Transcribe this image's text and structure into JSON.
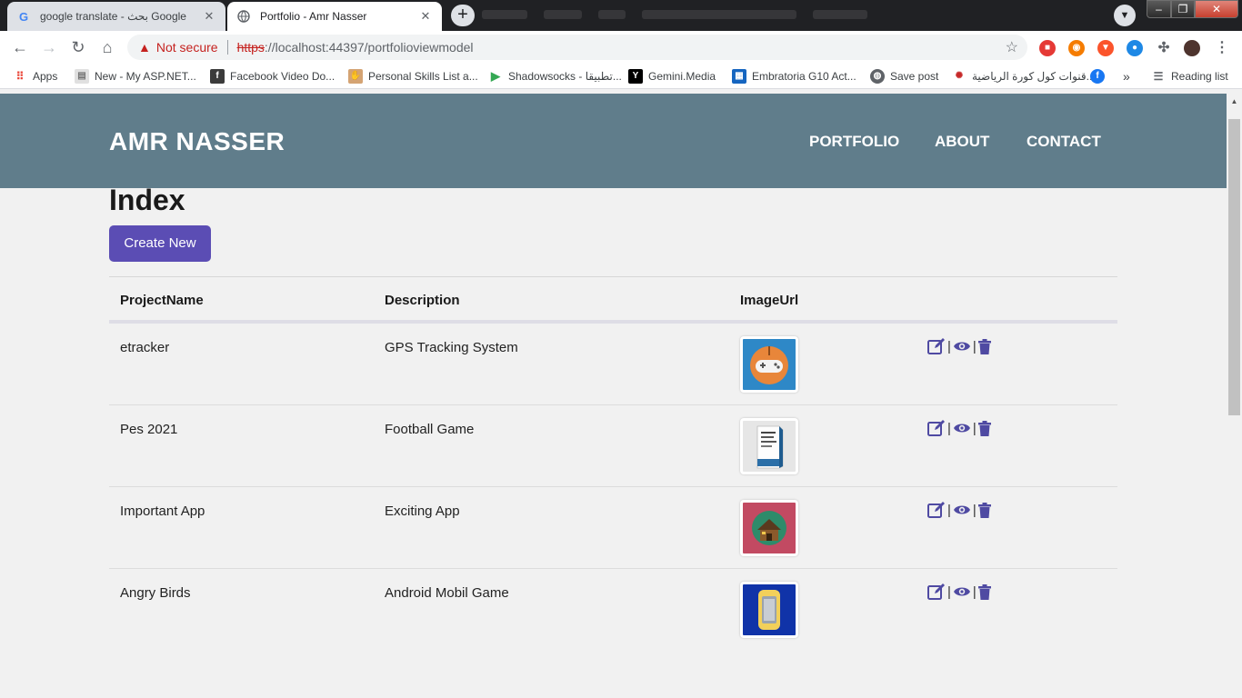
{
  "browser": {
    "tabs": [
      {
        "title": "google translate - بحث Google",
        "favicon": "google-icon",
        "active": false
      },
      {
        "title": "Portfolio - Amr Nasser",
        "favicon": "globe-icon",
        "active": true
      }
    ],
    "close_glyph": "✕",
    "new_tab_glyph": "+",
    "address": {
      "warning_label": "Not secure",
      "scheme": "https",
      "rest": "://localhost:44397/portfolioviewmodel"
    },
    "bookmarks": [
      {
        "label": "Apps",
        "icon": "apps-grid-icon",
        "color": "#4285f4"
      },
      {
        "label": "New - My ASP.NET...",
        "icon": "page-icon",
        "color": "#9e9e9e"
      },
      {
        "label": "Facebook Video Do...",
        "icon": "facebook-f-icon",
        "color": "#3b3b3b"
      },
      {
        "label": "Personal Skills List a...",
        "icon": "hand-icon",
        "color": "#d4a373"
      },
      {
        "label": "Shadowsocks - تطبيقا...",
        "icon": "play-store-icon",
        "color": "#34a853"
      },
      {
        "label": "Gemini.Media",
        "icon": "y-logo-icon",
        "color": "#000000"
      },
      {
        "label": "Embratoria G10 Act...",
        "icon": "site-icon",
        "color": "#1565c0"
      },
      {
        "label": "Save post",
        "icon": "globe-icon",
        "color": "#5f6368"
      },
      {
        "label": "قنوات كول كورة الرياضية...",
        "icon": "club-icon",
        "color": "#c62828"
      },
      {
        "label": "",
        "icon": "facebook-icon",
        "color": "#1877f2"
      }
    ],
    "bookmarks_more": "»",
    "reading_list": "Reading list"
  },
  "site": {
    "brand": "AMR NASSER",
    "nav": [
      "PORTFOLIO",
      "ABOUT",
      "CONTACT"
    ],
    "header_color": "#607d8b",
    "accent_color": "#5b4db4"
  },
  "page": {
    "title": "Index",
    "create_label": "Create New",
    "columns": [
      "ProjectName",
      "Description",
      "ImageUrl"
    ],
    "rows": [
      {
        "name": "etracker",
        "description": "GPS Tracking System",
        "image": "gamepad-thumbnail"
      },
      {
        "name": "Pes 2021",
        "description": "Football Game",
        "image": "book-cover-thumbnail"
      },
      {
        "name": "Important App",
        "description": "Exciting App",
        "image": "house-thumbnail"
      },
      {
        "name": "Angry Birds",
        "description": "Android Mobil Game",
        "image": "phone-thumbnail"
      }
    ],
    "actions": [
      "edit-icon",
      "view-eye-icon",
      "delete-trash-icon"
    ],
    "action_separator": "|"
  }
}
